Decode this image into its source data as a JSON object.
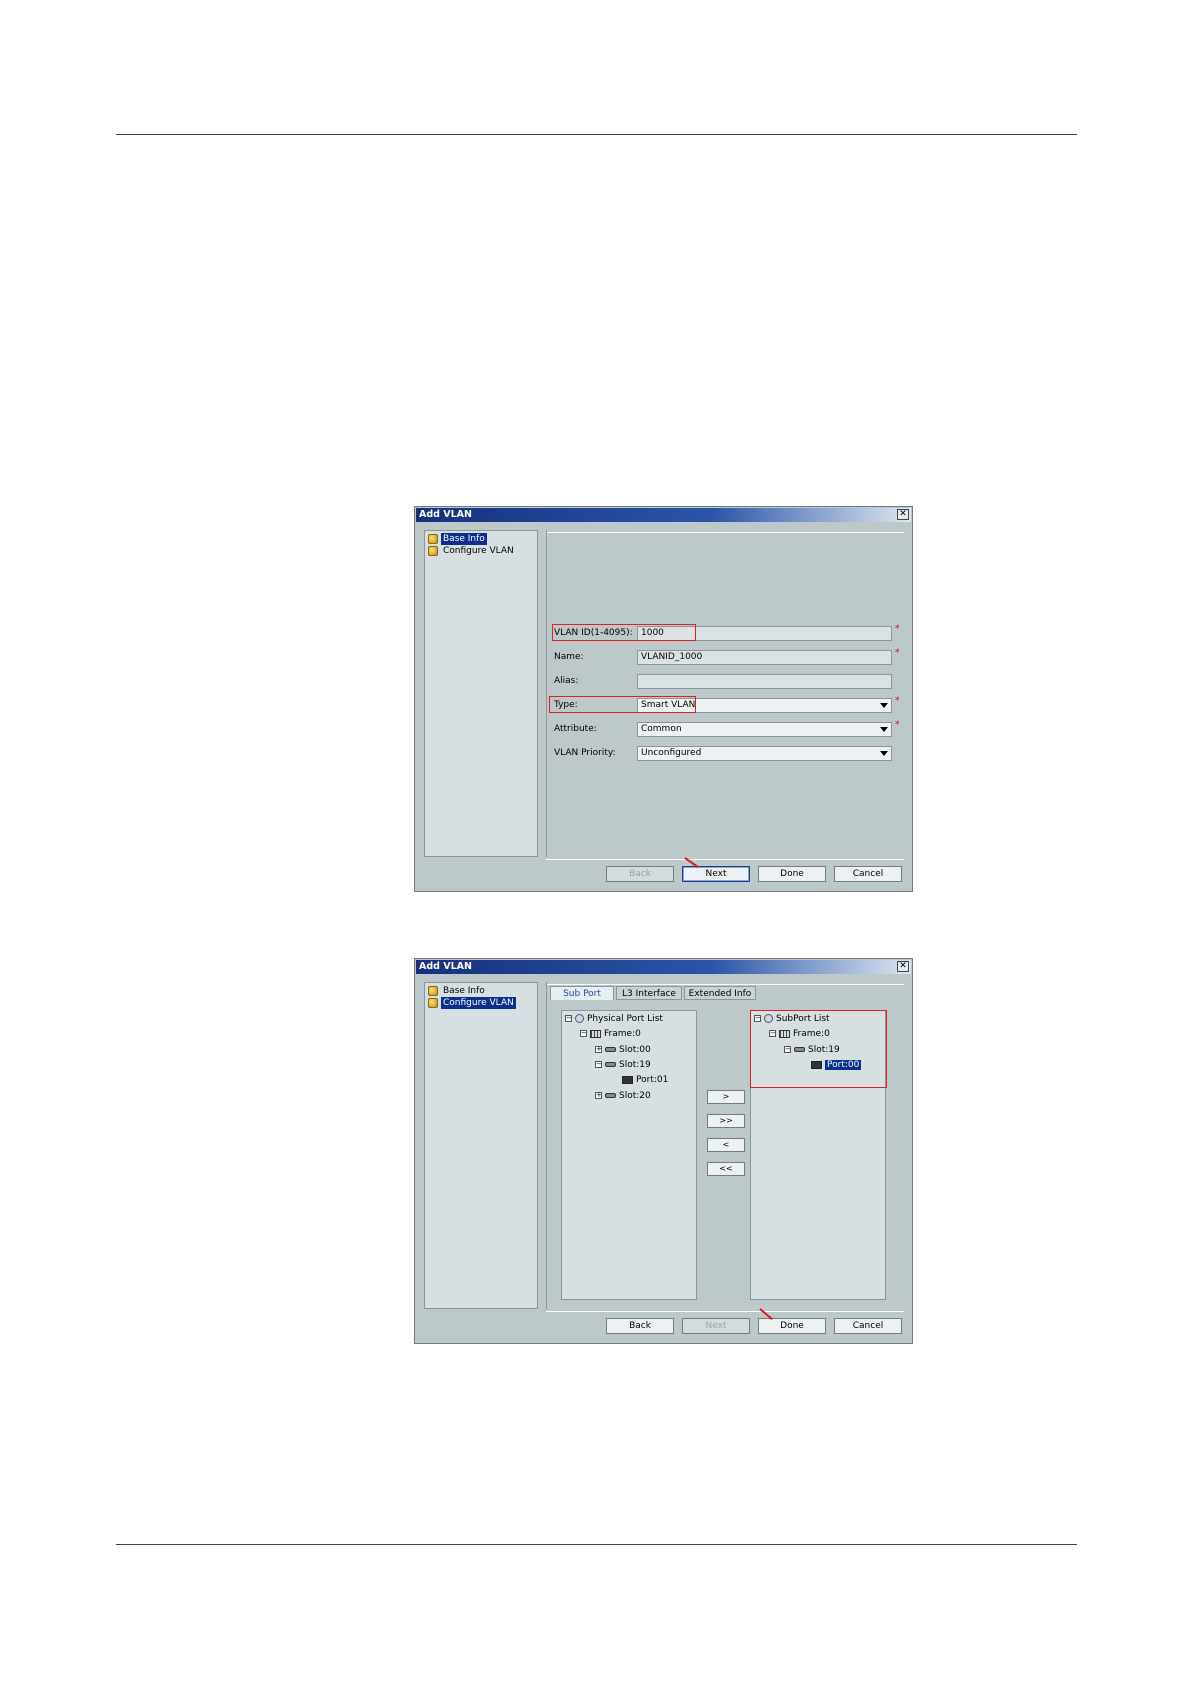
{
  "dialog1": {
    "title": "Add VLAN",
    "nav": [
      "Base Info",
      "Configure VLAN"
    ],
    "fields": {
      "vlan_id_label": "VLAN ID(1-4095):",
      "vlan_id_value": "1000",
      "name_label": "Name:",
      "name_value": "VLANID_1000",
      "alias_label": "Alias:",
      "alias_value": "",
      "type_label": "Type:",
      "type_value": "Smart VLAN",
      "attribute_label": "Attribute:",
      "attribute_value": "Common",
      "priority_label": "VLAN Priority:",
      "priority_value": "Unconfigured"
    },
    "required_mark": "*",
    "buttons": {
      "back": "Back",
      "next": "Next",
      "done": "Done",
      "cancel": "Cancel"
    }
  },
  "dialog2": {
    "title": "Add VLAN",
    "nav": [
      "Base Info",
      "Configure VLAN"
    ],
    "tabs": [
      "Sub Port",
      "L3 Interface",
      "Extended Info"
    ],
    "physical_tree": {
      "root": "Physical Port List",
      "frame": "Frame:0",
      "slot_a": "Slot:00",
      "slot_b": "Slot:19",
      "port": "Port:01",
      "slot_c": "Slot:20"
    },
    "sub_tree": {
      "root": "SubPort List",
      "frame": "Frame:0",
      "slot": "Slot:19",
      "port": "Port:00"
    },
    "move_buttons": [
      ">",
      ">>",
      "<",
      "<<"
    ],
    "buttons": {
      "back": "Back",
      "next": "Next",
      "done": "Done",
      "cancel": "Cancel"
    }
  },
  "colors": {
    "dialog_bg": "#bcc8c9",
    "highlight": "#e02020",
    "selection": "#0a2f8e"
  }
}
